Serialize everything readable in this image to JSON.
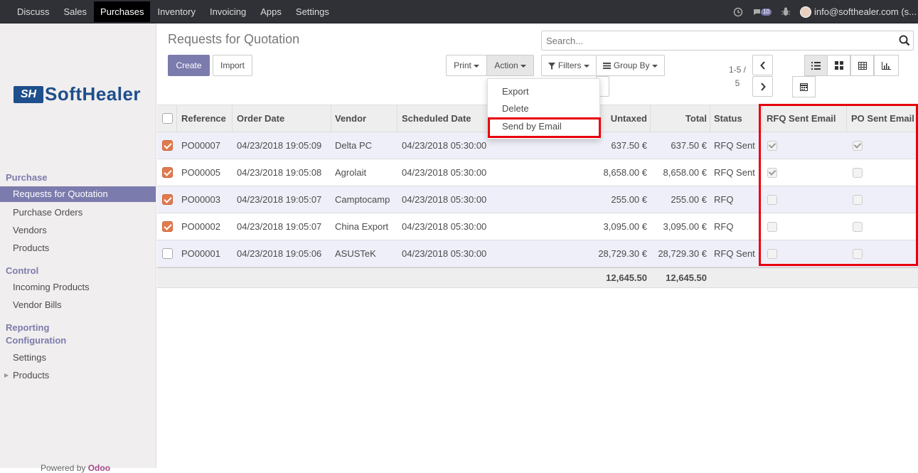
{
  "topnav": {
    "items": [
      "Discuss",
      "Sales",
      "Purchases",
      "Inventory",
      "Invoicing",
      "Apps",
      "Settings"
    ],
    "active": "Purchases",
    "message_count": "10",
    "user": "info@softhealer.com (s..."
  },
  "logo": {
    "mark": "SH",
    "text": "SoftHealer"
  },
  "sidebar": {
    "section_purchase": "Purchase",
    "purchase_items": [
      "Requests for Quotation",
      "Purchase Orders",
      "Vendors",
      "Products"
    ],
    "section_control": "Control",
    "control_items": [
      "Incoming Products",
      "Vendor Bills"
    ],
    "section_reporting": "Reporting",
    "section_configuration": "Configuration",
    "config_items": [
      "Settings",
      "Products"
    ],
    "powered_by": "Powered by",
    "powered_brand": "Odoo"
  },
  "control": {
    "title": "Requests for Quotation",
    "create": "Create",
    "import": "Import",
    "print": "Print",
    "action": "Action",
    "filters": "Filters",
    "group_by": "Group By",
    "search_placeholder": "Search...",
    "pager_range": "1-5 /",
    "pager_total": "5"
  },
  "action_menu": [
    "Export",
    "Delete",
    "Send by Email"
  ],
  "table": {
    "headers": [
      "Reference",
      "Order Date",
      "Vendor",
      "Scheduled Date",
      "Untaxed",
      "Total",
      "Status",
      "RFQ Sent Email",
      "PO Sent Email"
    ],
    "rows": [
      {
        "selected": true,
        "ref": "PO00007",
        "order_date": "04/23/2018 19:05:09",
        "vendor": "Delta PC",
        "scheduled": "04/23/2018 05:30:00",
        "untaxed": "637.50 €",
        "total": "637.50 €",
        "status": "RFQ Sent",
        "rfq_sent": true,
        "po_sent": true
      },
      {
        "selected": true,
        "ref": "PO00005",
        "order_date": "04/23/2018 19:05:08",
        "vendor": "Agrolait",
        "scheduled": "04/23/2018 05:30:00",
        "untaxed": "8,658.00 €",
        "total": "8,658.00 €",
        "status": "RFQ Sent",
        "rfq_sent": true,
        "po_sent": false
      },
      {
        "selected": true,
        "ref": "PO00003",
        "order_date": "04/23/2018 19:05:07",
        "vendor": "Camptocamp",
        "scheduled": "04/23/2018 05:30:00",
        "untaxed": "255.00 €",
        "total": "255.00 €",
        "status": "RFQ",
        "rfq_sent": false,
        "po_sent": false
      },
      {
        "selected": true,
        "ref": "PO00002",
        "order_date": "04/23/2018 19:05:07",
        "vendor": "China Export",
        "scheduled": "04/23/2018 05:30:00",
        "untaxed": "3,095.00 €",
        "total": "3,095.00 €",
        "status": "RFQ",
        "rfq_sent": false,
        "po_sent": false
      },
      {
        "selected": false,
        "ref": "PO00001",
        "order_date": "04/23/2018 19:05:06",
        "vendor": "ASUSTeK",
        "scheduled": "04/23/2018 05:30:00",
        "untaxed": "28,729.30 €",
        "total": "28,729.30 €",
        "status": "RFQ Sent",
        "rfq_sent": false,
        "po_sent": false
      }
    ],
    "footer_untaxed": "12,645.50",
    "footer_total": "12,645.50"
  },
  "colors": {
    "brand": "#7c7bad",
    "checkbox": "#e07a4f",
    "highlight": "#e8000d",
    "topbar": "#2f3136"
  }
}
